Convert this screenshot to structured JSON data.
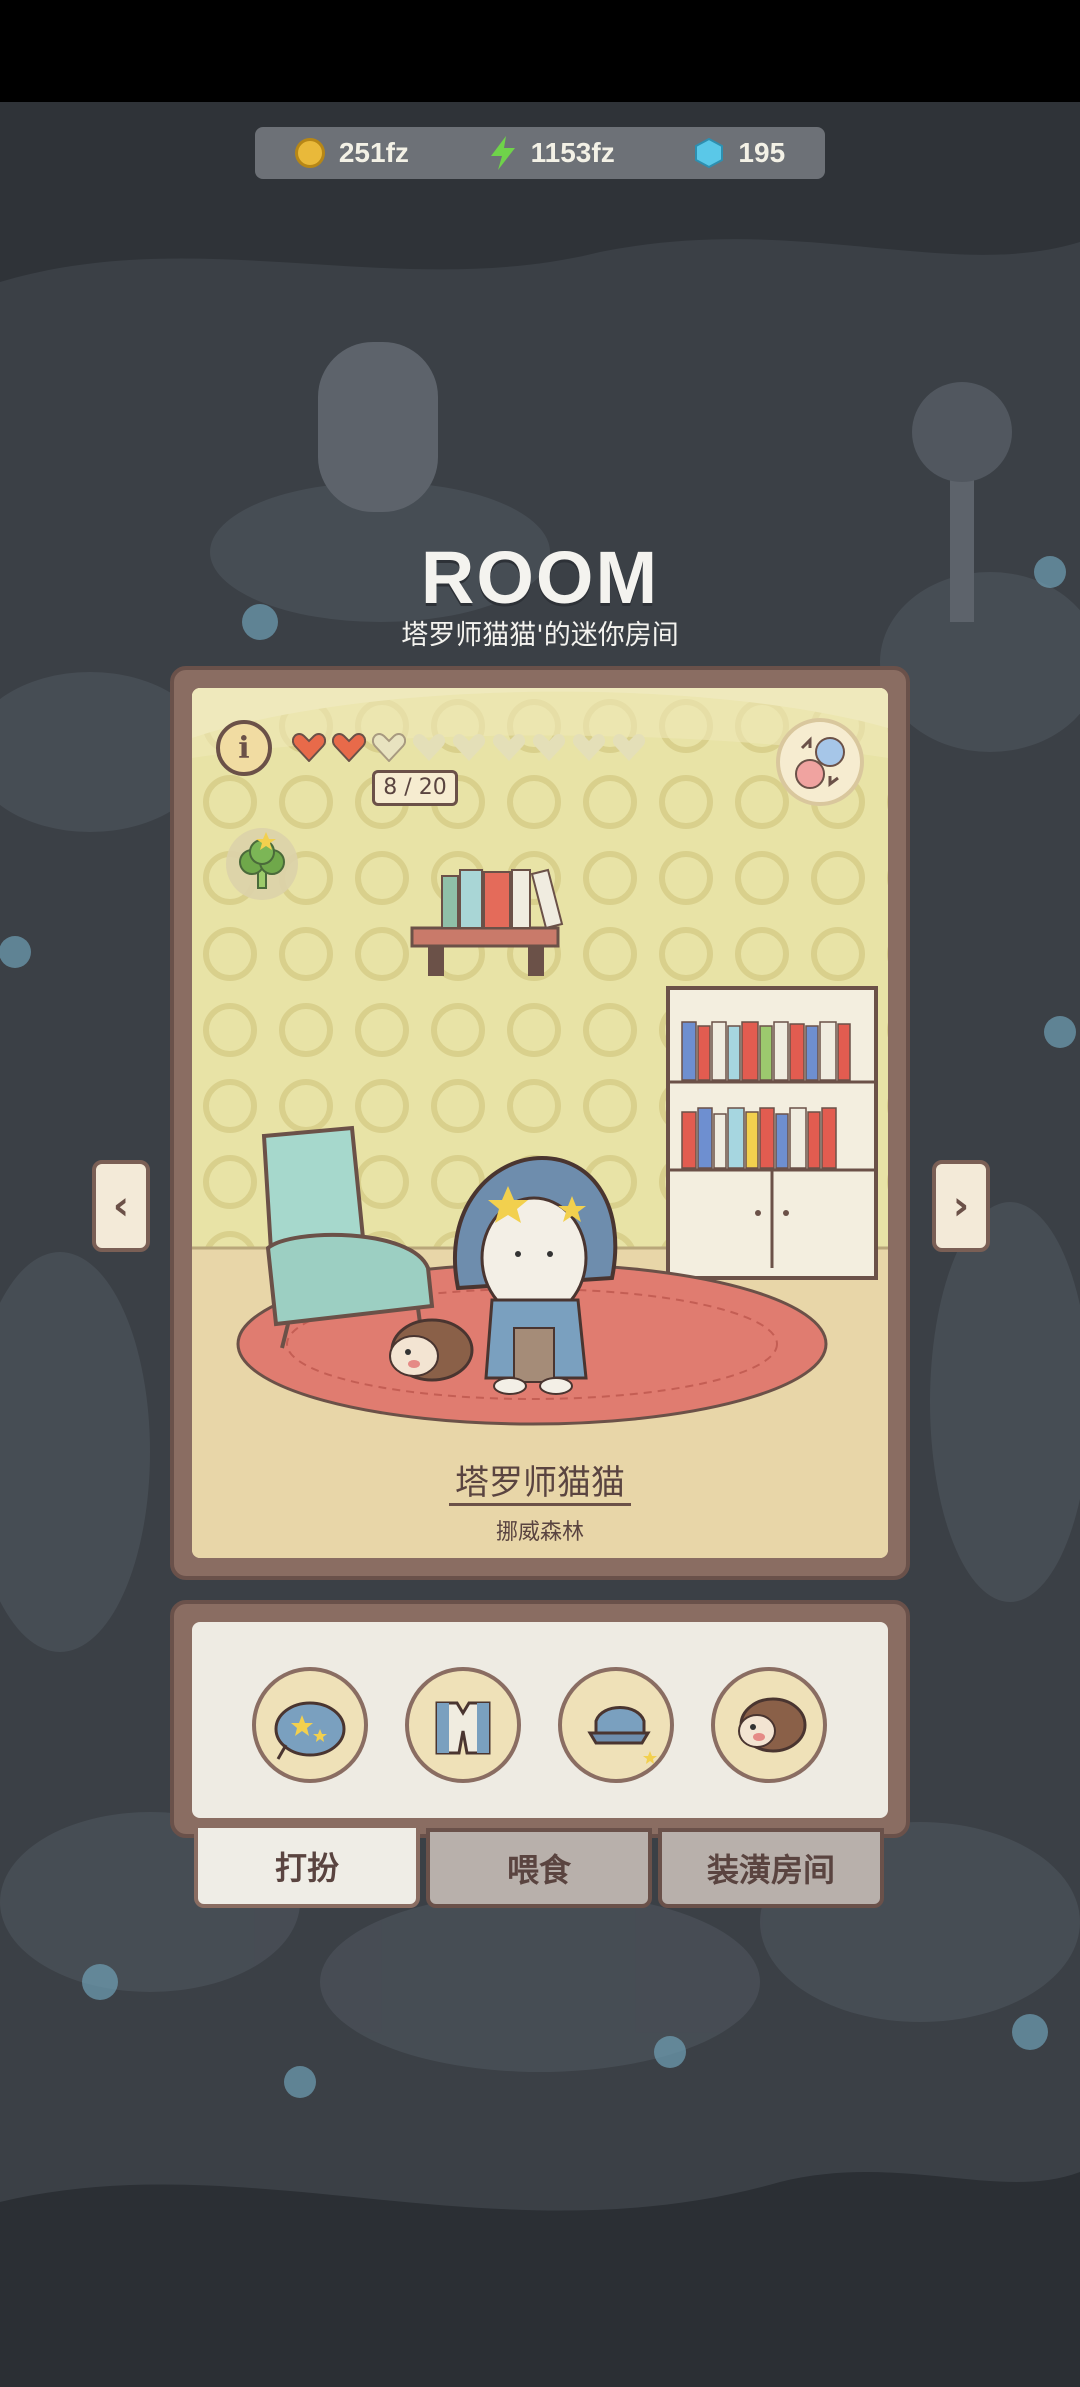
{
  "currency": {
    "coins": "251fz",
    "energy": "1153fz",
    "gems": "195"
  },
  "header": {
    "title": "ROOM",
    "subtitle": "塔罗师猫猫'的迷你房间"
  },
  "room": {
    "hearts_filled": 2,
    "hearts_total": 10,
    "heart_count": "8 / 20",
    "cat_name": "塔罗师猫猫",
    "cat_location": "挪威森林"
  },
  "items": [
    {
      "icon": "star-hat-icon"
    },
    {
      "icon": "vest-icon"
    },
    {
      "icon": "cap-icon"
    },
    {
      "icon": "hedgehog-icon"
    }
  ],
  "tabs": [
    {
      "label": "打扮",
      "active": true
    },
    {
      "label": "喂食",
      "active": false
    },
    {
      "label": "装潢房间",
      "active": false
    }
  ],
  "colors": {
    "frame": "#8a6d62",
    "room_wall": "#e8e0a0",
    "room_floor": "#e8d6a8",
    "rug": "#e07c70",
    "heart_filled": "#e86a4a"
  }
}
